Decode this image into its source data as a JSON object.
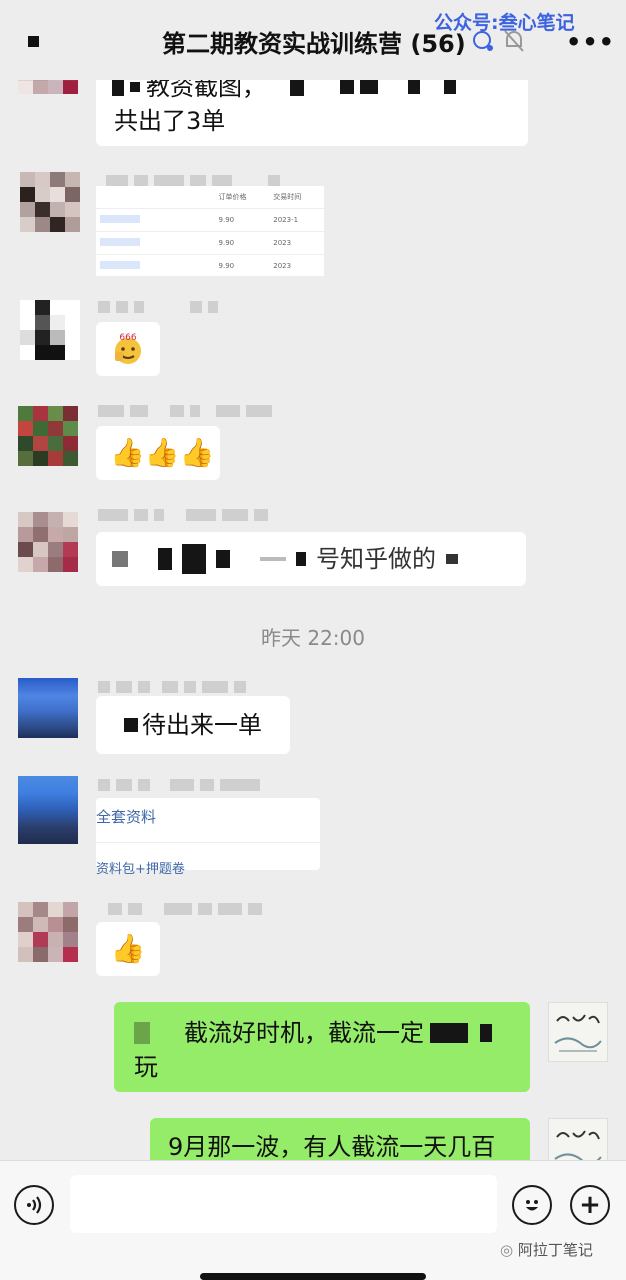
{
  "header": {
    "title": "第二期教资实战训练营 (56)",
    "more_label": "•••",
    "watermark": "公众号:叁心笔记"
  },
  "messages": {
    "m1": {
      "text_a": "教资截图，",
      "text_b": "共出了3单"
    },
    "m2": {
      "order_headers": [
        "订单价格",
        "交易时间"
      ],
      "order_rows": [
        {
          "price": "9.90",
          "time": "2023-1"
        },
        {
          "price": "9.90",
          "time": "2023"
        },
        {
          "price": "9.90",
          "time": "2023"
        }
      ]
    },
    "m3": {
      "emoji": "666"
    },
    "m4": {
      "thumbs": "👍👍👍"
    },
    "m5": {
      "text": "号知乎做的"
    },
    "time_divider": "昨天 22:00",
    "m6": {
      "text": "待出来一单"
    },
    "m7": {
      "line1": "全套资料",
      "line2": "资料包+押题卷"
    },
    "m8": {
      "thumbs": "👍"
    },
    "m9": {
      "text_a": "截流好时机，截流一定",
      "text_b": "玩"
    },
    "m10": {
      "text": "9月那一波，有人截流一天几百"
    }
  },
  "input_bar": {
    "voice_icon": "voice-icon",
    "emoji_icon": "emoji-icon",
    "plus_label": "+",
    "watermark": "阿拉丁笔记"
  },
  "colors": {
    "background": "#ededed",
    "bubble_self": "#95ec69",
    "bubble_other": "#ffffff",
    "link": "#3f67a8"
  }
}
